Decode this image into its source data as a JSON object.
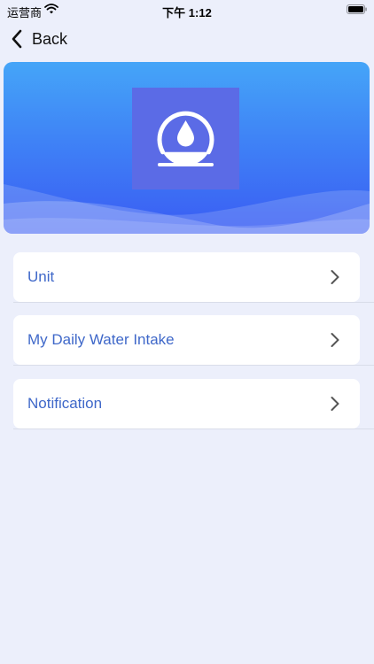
{
  "status_bar": {
    "carrier": "运营商",
    "time": "下午 1:12"
  },
  "nav": {
    "back_label": "Back"
  },
  "banner": {
    "logo_icon": "water-drop-icon"
  },
  "menu": {
    "items": [
      {
        "label": "Unit"
      },
      {
        "label": "My Daily Water Intake"
      },
      {
        "label": "Notification"
      }
    ]
  },
  "colors": {
    "background": "#eceffb",
    "accent_text": "#3f68c9",
    "banner_top": "#45a5f8",
    "banner_bottom": "#3a5cf3"
  }
}
